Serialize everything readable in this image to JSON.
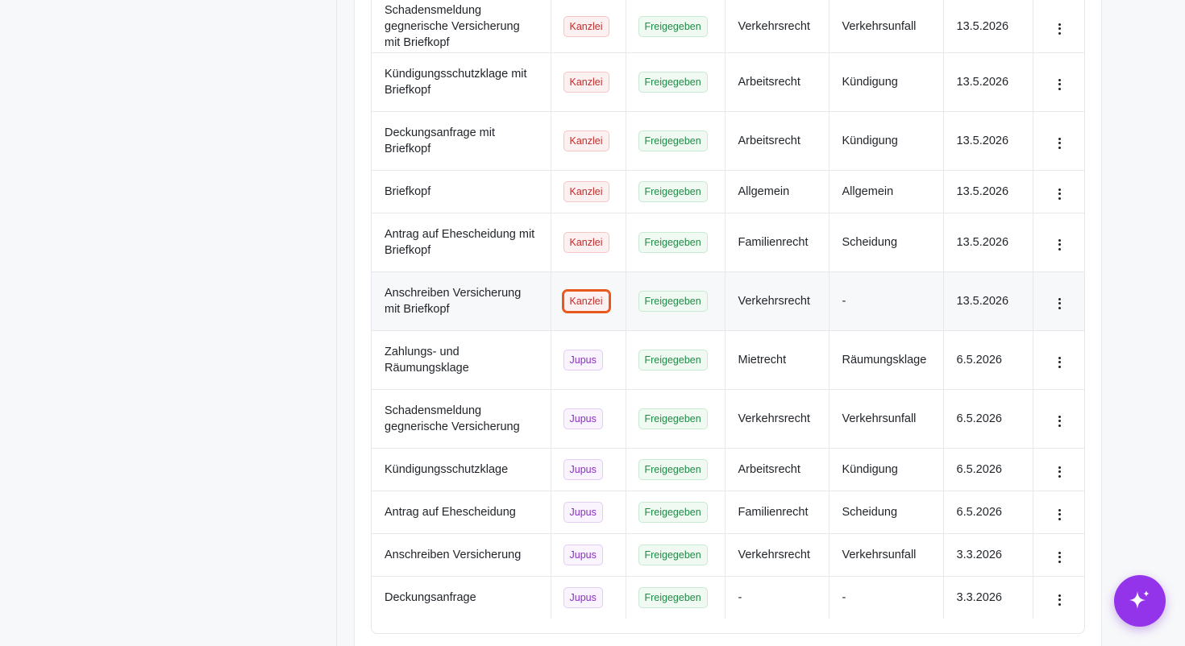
{
  "table": {
    "rows": [
      {
        "name": "Schadensmeldung gegnerische Versicherung mit Briefkopf",
        "source": "Kanzlei",
        "status": "Freigegeben",
        "area": "Verkehrsrecht",
        "category": "Verkehrsunfall",
        "date": "13.5.2026"
      },
      {
        "name": "Kündigungsschutzklage mit Briefkopf",
        "source": "Kanzlei",
        "status": "Freigegeben",
        "area": "Arbeitsrecht",
        "category": "Kündigung",
        "date": "13.5.2026"
      },
      {
        "name": "Deckungsanfrage mit Briefkopf",
        "source": "Kanzlei",
        "status": "Freigegeben",
        "area": "Arbeitsrecht",
        "category": "Kündigung",
        "date": "13.5.2026"
      },
      {
        "name": "Briefkopf",
        "source": "Kanzlei",
        "status": "Freigegeben",
        "area": "Allgemein",
        "category": "Allgemein",
        "date": "13.5.2026"
      },
      {
        "name": "Antrag auf Ehescheidung mit Briefkopf",
        "source": "Kanzlei",
        "status": "Freigegeben",
        "area": "Familienrecht",
        "category": "Scheidung",
        "date": "13.5.2026"
      },
      {
        "name": "Anschreiben Versicherung mit Briefkopf",
        "source": "Kanzlei",
        "status": "Freigegeben",
        "area": "Verkehrsrecht",
        "category": "-",
        "date": "13.5.2026"
      },
      {
        "name": "Zahlungs- und Räumungsklage",
        "source": "Jupus",
        "status": "Freigegeben",
        "area": "Mietrecht",
        "category": "Räumungsklage",
        "date": "6.5.2026"
      },
      {
        "name": "Schadensmeldung gegnerische Versicherung",
        "source": "Jupus",
        "status": "Freigegeben",
        "area": "Verkehrsrecht",
        "category": "Verkehrsunfall",
        "date": "6.5.2026"
      },
      {
        "name": "Kündigungsschutzklage",
        "source": "Jupus",
        "status": "Freigegeben",
        "area": "Arbeitsrecht",
        "category": "Kündigung",
        "date": "6.5.2026"
      },
      {
        "name": "Antrag auf Ehescheidung",
        "source": "Jupus",
        "status": "Freigegeben",
        "area": "Familienrecht",
        "category": "Scheidung",
        "date": "6.5.2026"
      },
      {
        "name": "Anschreiben Versicherung",
        "source": "Jupus",
        "status": "Freigegeben",
        "area": "Verkehrsrecht",
        "category": "Verkehrsunfall",
        "date": "3.3.2026"
      },
      {
        "name": "Deckungsanfrage",
        "source": "Jupus",
        "status": "Freigegeben",
        "area": "-",
        "category": "-",
        "date": "3.3.2026"
      }
    ]
  },
  "fab": {
    "icon": "sparkle-icon",
    "color": "#9333ea"
  }
}
